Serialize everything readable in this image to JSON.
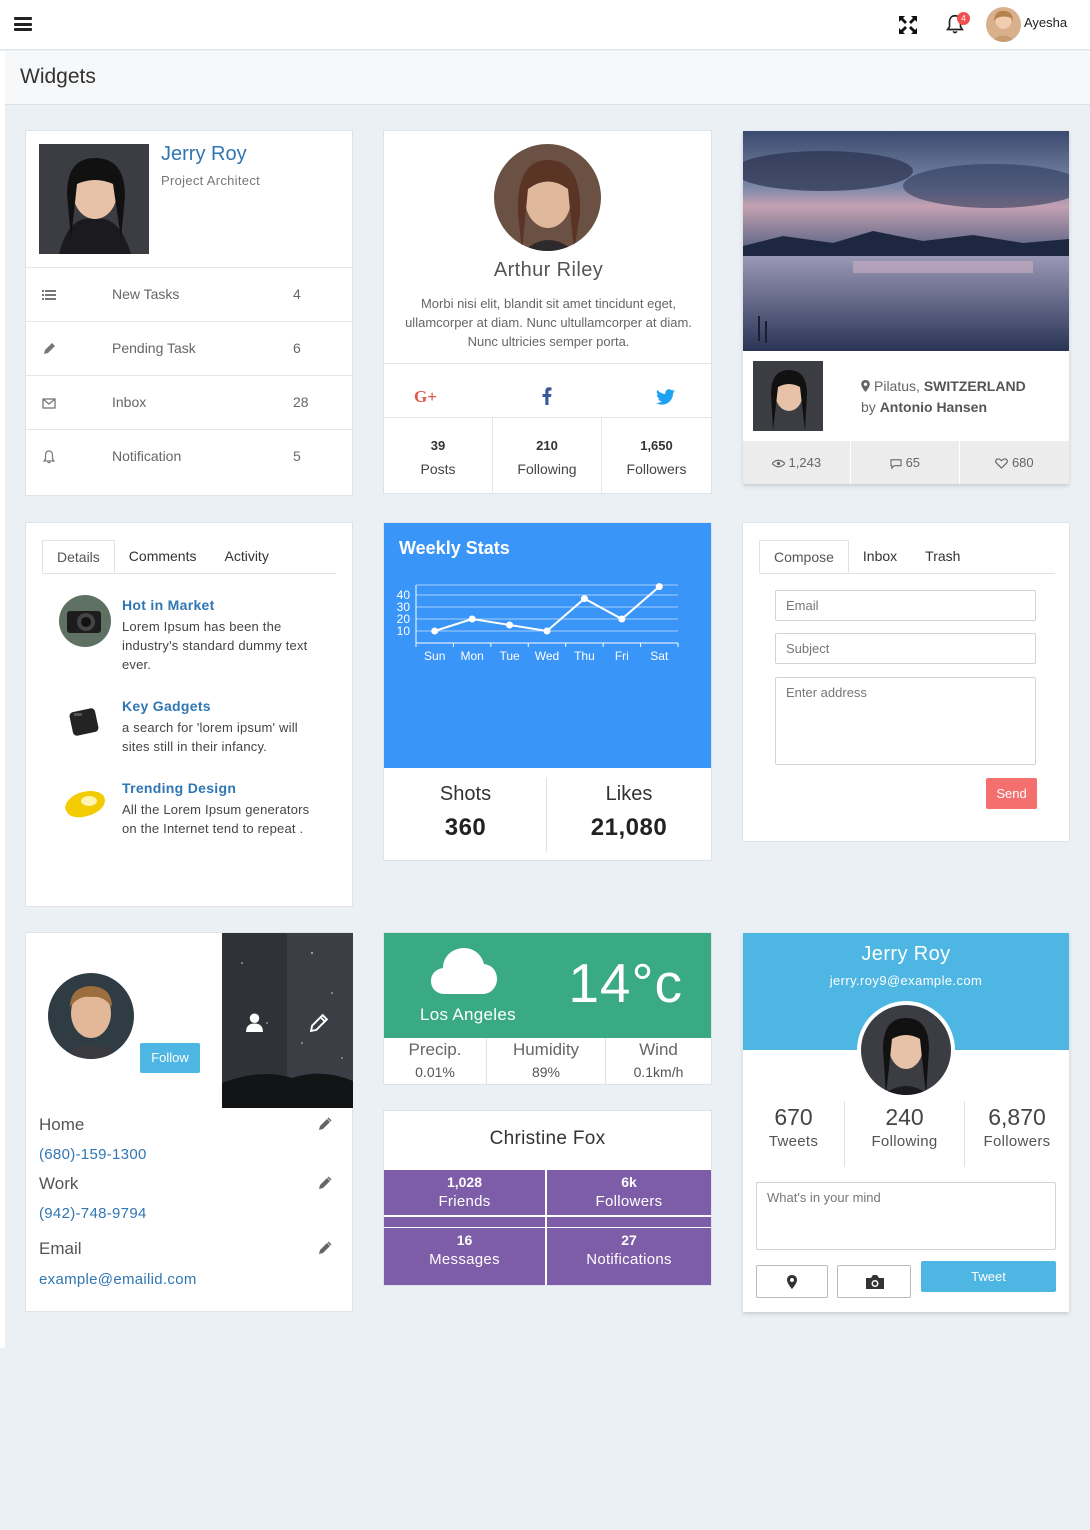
{
  "topbar": {
    "user_name": "Ayesha",
    "notification_count": "4"
  },
  "page": {
    "title": "Widgets"
  },
  "profile_card": {
    "name": "Jerry Roy",
    "role": "Project Architect",
    "items": [
      {
        "icon": "list-icon",
        "label": "New Tasks",
        "count": "4"
      },
      {
        "icon": "pencil-icon",
        "label": "Pending Task",
        "count": "6"
      },
      {
        "icon": "envelope-icon",
        "label": "Inbox",
        "count": "28"
      },
      {
        "icon": "bell-icon",
        "label": "Notification",
        "count": "5"
      }
    ]
  },
  "social_card": {
    "name": "Arthur Riley",
    "bio": "Morbi nisi elit, blandit sit amet tincidunt eget, ullamcorper at diam. Nunc ultullamcorper at diam. Nunc ultricies semper porta.",
    "stats": [
      {
        "value": "39",
        "label": "Posts"
      },
      {
        "value": "210",
        "label": "Following"
      },
      {
        "value": "1,650",
        "label": "Followers"
      }
    ]
  },
  "photo_card": {
    "location": "Pilatus,",
    "country": "SWITZERLAND",
    "by": "by",
    "author": "Antonio Hansen",
    "views": "1,243",
    "comments": "65",
    "likes": "680"
  },
  "feed_card": {
    "tabs": [
      "Details",
      "Comments",
      "Activity"
    ],
    "items": [
      {
        "title": "Hot in Market",
        "text": "Lorem Ipsum has been the industry's standard dummy text ever."
      },
      {
        "title": "Key Gadgets",
        "text": "a search for 'lorem ipsum' will sites still in their infancy."
      },
      {
        "title": "Trending Design",
        "text": "All the Lorem Ipsum generators on the Internet tend to repeat ."
      }
    ]
  },
  "weekly_card": {
    "title": "Weekly Stats",
    "shots_label": "Shots",
    "shots_value": "360",
    "likes_label": "Likes",
    "likes_value": "21,080"
  },
  "chart_data": {
    "type": "line",
    "categories": [
      "Sun",
      "Mon",
      "Tue",
      "Wed",
      "Thu",
      "Fri",
      "Sat"
    ],
    "values": [
      10,
      20,
      15,
      10,
      37,
      20,
      47
    ],
    "yticks": [
      10,
      20,
      30,
      40
    ],
    "ylim": [
      0,
      50
    ],
    "grid": true,
    "color": "#ffffff"
  },
  "compose_card": {
    "tabs": [
      "Compose",
      "Inbox",
      "Trash"
    ],
    "email_placeholder": "Email",
    "subject_placeholder": "Subject",
    "address_placeholder": "Enter address",
    "send_label": "Send"
  },
  "contact_card": {
    "follow_label": "Follow",
    "fields": [
      {
        "label": "Home",
        "value": "(680)-159-1300"
      },
      {
        "label": "Work",
        "value": "(942)-748-9794"
      },
      {
        "label": "Email",
        "value": "example@emailid.com"
      }
    ]
  },
  "weather_card": {
    "temperature": "14°c",
    "city": "Los Angeles",
    "stats": [
      {
        "label": "Precip.",
        "value": "0.01%"
      },
      {
        "label": "Humidity",
        "value": "89%"
      },
      {
        "label": "Wind",
        "value": "0.1km/h"
      }
    ]
  },
  "fox_card": {
    "name": "Christine Fox",
    "cells": [
      {
        "value": "1,028",
        "label": "Friends"
      },
      {
        "value": "6k",
        "label": "Followers"
      },
      {
        "value": "16",
        "label": "Messages"
      },
      {
        "value": "27",
        "label": "Notifications"
      }
    ]
  },
  "tweet_card": {
    "name": "Jerry Roy",
    "email": "jerry.roy9@example.com",
    "stats": [
      {
        "value": "670",
        "label": "Tweets"
      },
      {
        "value": "240",
        "label": "Following"
      },
      {
        "value": "6,870",
        "label": "Followers"
      }
    ],
    "placeholder": "What's in your mind",
    "tweet_label": "Tweet"
  },
  "colors": {
    "blue": "#3a95f8",
    "teal": "#3aaa85",
    "purple": "#7d5ca8",
    "light_blue": "#4db6e2",
    "red_button": "#f4706f",
    "link": "#3076b4"
  }
}
